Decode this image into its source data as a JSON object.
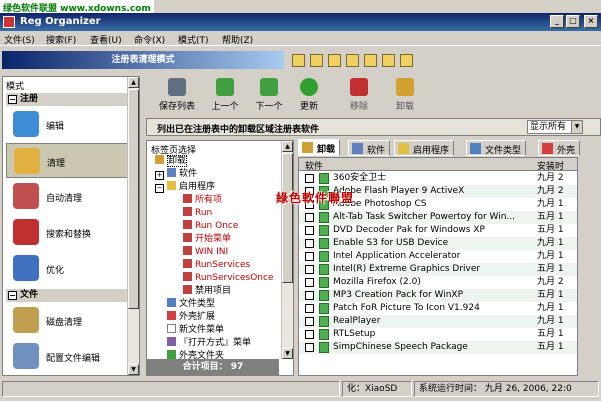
{
  "watermark": "绿色软件联盟 www.xdowns.com",
  "window": {
    "title": "Reg Organizer",
    "min": "_",
    "max": "□",
    "close": "×"
  },
  "menu": [
    "文件(S)",
    "搜索(F)",
    "查看(U)",
    "命令(X)",
    "模式(T)",
    "帮助(Z)"
  ],
  "mode_title": "注册表清理模式",
  "left": {
    "header": "模式",
    "sections": [
      {
        "label": "注册",
        "toggle": "−",
        "items": [
          {
            "label": "编辑",
            "icon": "edit-icon",
            "color": "#3c8dd6"
          },
          {
            "label": "清理",
            "icon": "broom-icon",
            "color": "#e0b040",
            "selected": true
          },
          {
            "label": "自动清理",
            "icon": "auto-clean-icon",
            "color": "#c05050"
          },
          {
            "label": "搜索和替换",
            "icon": "search-replace-icon",
            "color": "#c03030"
          },
          {
            "label": "优化",
            "icon": "optimize-icon",
            "color": "#4070c0"
          }
        ]
      },
      {
        "label": "文件",
        "toggle": "−",
        "items": [
          {
            "label": "磁盘清理",
            "icon": "disk-clean-icon",
            "color": "#c0a050"
          },
          {
            "label": "配置文件编辑",
            "icon": "config-edit-icon",
            "color": "#7090c0"
          }
        ]
      }
    ]
  },
  "toolbar": [
    {
      "label": "保存列表",
      "icon": "save-list-icon",
      "color": "#607080"
    },
    {
      "label": "上一个",
      "icon": "prev-icon",
      "color": "#40a040"
    },
    {
      "label": "下一个",
      "icon": "next-icon",
      "color": "#40a040"
    },
    {
      "label": "更新",
      "icon": "refresh-icon",
      "color": "#30a030"
    },
    {
      "label": "移除",
      "icon": "remove-icon",
      "color": "#c03030",
      "dim": true
    },
    {
      "label": "卸载",
      "icon": "uninstall-icon",
      "color": "#d0a030",
      "dim": true
    }
  ],
  "info": {
    "text": "列出已在注册表中的卸载区域注册表软件",
    "filter": "显示所有"
  },
  "tree": {
    "header": "标签页选择",
    "nodes": [
      {
        "label": "卸载",
        "level": 0,
        "toggle": "",
        "sel": true
      },
      {
        "label": "软件",
        "level": 0,
        "toggle": "+"
      },
      {
        "label": "启用程序",
        "level": 0,
        "toggle": "−"
      },
      {
        "label": "所有项",
        "level": 1
      },
      {
        "label": "Run",
        "level": 1
      },
      {
        "label": "Run Once",
        "level": 1
      },
      {
        "label": "开始菜单",
        "level": 1
      },
      {
        "label": "WIN INI",
        "level": 1
      },
      {
        "label": "RunServices",
        "level": 1
      },
      {
        "label": "RunServicesOnce",
        "level": 1
      },
      {
        "label": "禁用项目",
        "level": 1,
        "plain": true
      },
      {
        "label": "文件类型",
        "level": 0,
        "toggle": ""
      },
      {
        "label": "外壳扩展",
        "level": 0,
        "toggle": ""
      },
      {
        "label": "新文件菜单",
        "level": 0,
        "toggle": ""
      },
      {
        "label": "『打开方式』菜单",
        "level": 0,
        "toggle": ""
      },
      {
        "label": "外壳文件夹",
        "level": 0,
        "toggle": ""
      }
    ],
    "footer": "合计项目： 97"
  },
  "tabs": [
    {
      "label": "卸载",
      "active": true,
      "icon": "uninstall-tab-icon"
    },
    {
      "label": "软件",
      "icon": "software-tab-icon"
    },
    {
      "label": "启用程序",
      "icon": "startup-tab-icon"
    },
    {
      "label": "文件类型",
      "icon": "filetype-tab-icon"
    },
    {
      "label": "外壳",
      "icon": "shell-tab-icon"
    }
  ],
  "list": {
    "columns": [
      "软件",
      "安装时"
    ],
    "rows": [
      {
        "name": "360安全卫士",
        "date": "九月 2"
      },
      {
        "name": "Adobe Flash Player 9 ActiveX",
        "date": "九月 2"
      },
      {
        "name": "Adobe Photoshop CS",
        "date": "九月 1"
      },
      {
        "name": "Alt-Tab Task Switcher Powertoy for Win...",
        "date": "五月 1"
      },
      {
        "name": "DVD Decoder Pak for Windows XP",
        "date": "五月 1"
      },
      {
        "name": "Enable S3 for USB Device",
        "date": "九月 1"
      },
      {
        "name": "Intel Application Accelerator",
        "date": "九月 1"
      },
      {
        "name": "Intel(R) Extreme Graphics Driver",
        "date": "五月 1"
      },
      {
        "name": "Mozilla Firefox (2.0)",
        "date": "九月 2"
      },
      {
        "name": "MP3 Creation Pack for WinXP",
        "date": "五月 1"
      },
      {
        "name": "Patch FoR Picture To Icon V1.924",
        "date": "九月 1"
      },
      {
        "name": "RealPlayer",
        "date": "九月 1"
      },
      {
        "name": "RTLSetup",
        "date": "五月 1"
      },
      {
        "name": "SimpChinese Speech Package",
        "date": "五月 1"
      }
    ]
  },
  "overlay_text": "綠色軟件聯盟",
  "status": {
    "left": "",
    "mid": "化：XiaoSD",
    "right": "系统运行时间： 九月 26, 2006, 22:0"
  }
}
